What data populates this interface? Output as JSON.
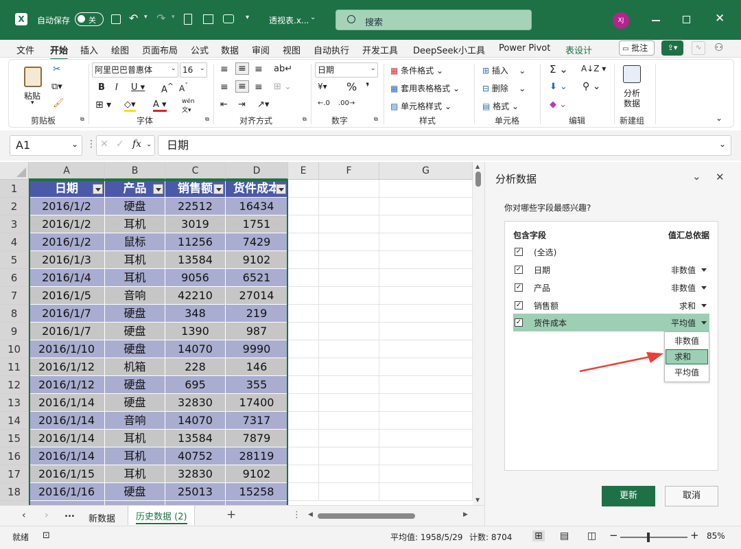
{
  "titlebar": {
    "autosave_label": "自动保存",
    "autosave_state": "关",
    "filename": "透视表.x...",
    "search_placeholder": "搜索",
    "user_initials": "XJ"
  },
  "menu": {
    "tabs": [
      "文件",
      "开始",
      "插入",
      "绘图",
      "页面布局",
      "公式",
      "数据",
      "审阅",
      "视图",
      "自动执行",
      "开发工具",
      "DeepSeek小工具",
      "Power Pivot",
      "表设计"
    ],
    "active": "开始",
    "comments_label": "批注"
  },
  "ribbon": {
    "paste_label": "粘贴",
    "font_name": "阿里巴巴普惠体",
    "font_size": "16",
    "number_format": "日期",
    "cond_format": "条件格式",
    "table_format": "套用表格格式",
    "cell_style": "单元格样式",
    "insert": "插入",
    "delete": "删除",
    "format": "格式",
    "analyze_line1": "分析",
    "analyze_line2": "数据",
    "groups": [
      "剪贴板",
      "字体",
      "对齐方式",
      "数字",
      "样式",
      "单元格",
      "编辑",
      "新建组"
    ]
  },
  "formulabar": {
    "cell_ref": "A1",
    "formula": "日期"
  },
  "sheet": {
    "columns": [
      "A",
      "B",
      "C",
      "D",
      "E",
      "F",
      "G"
    ],
    "headers": [
      "日期",
      "产品",
      "销售额",
      "货件成本"
    ],
    "rows": [
      [
        "2016/1/2",
        "硬盘",
        "22512",
        "16434"
      ],
      [
        "2016/1/2",
        "耳机",
        "3019",
        "1751"
      ],
      [
        "2016/1/2",
        "鼠标",
        "11256",
        "7429"
      ],
      [
        "2016/1/3",
        "耳机",
        "13584",
        "9102"
      ],
      [
        "2016/1/4",
        "耳机",
        "9056",
        "6521"
      ],
      [
        "2016/1/5",
        "音响",
        "42210",
        "27014"
      ],
      [
        "2016/1/7",
        "硬盘",
        "348",
        "219"
      ],
      [
        "2016/1/7",
        "硬盘",
        "1390",
        "987"
      ],
      [
        "2016/1/10",
        "硬盘",
        "14070",
        "9990"
      ],
      [
        "2016/1/12",
        "机箱",
        "228",
        "146"
      ],
      [
        "2016/1/12",
        "硬盘",
        "695",
        "355"
      ],
      [
        "2016/1/14",
        "硬盘",
        "32830",
        "17400"
      ],
      [
        "2016/1/14",
        "音响",
        "14070",
        "7317"
      ],
      [
        "2016/1/14",
        "耳机",
        "13584",
        "7879"
      ],
      [
        "2016/1/14",
        "耳机",
        "40752",
        "28119"
      ],
      [
        "2016/1/15",
        "耳机",
        "32830",
        "9102"
      ],
      [
        "2016/1/16",
        "硬盘",
        "25013",
        "15258"
      ]
    ],
    "row_numbers": [
      "1",
      "2",
      "3",
      "4",
      "5",
      "6",
      "7",
      "8",
      "9",
      "10",
      "11",
      "12",
      "13",
      "14",
      "15",
      "16",
      "17",
      "18"
    ]
  },
  "tabs": {
    "ellipsis": "...",
    "sheet1": "新数据",
    "sheet2": "历史数据 (2)",
    "add": "+"
  },
  "panel": {
    "title": "分析数据",
    "question": "你对哪些字段最感兴趣?",
    "col_include": "包含字段",
    "col_summary": "值汇总依据",
    "fields": [
      {
        "name": "(全选)",
        "summary": ""
      },
      {
        "name": "日期",
        "summary": "非数值"
      },
      {
        "name": "产品",
        "summary": "非数值"
      },
      {
        "name": "销售额",
        "summary": "求和"
      },
      {
        "name": "货件成本",
        "summary": "平均值"
      }
    ],
    "dropdown_options": [
      "非数值",
      "求和",
      "平均值"
    ],
    "update_button": "更新",
    "cancel_button": "取消"
  },
  "status": {
    "ready": "就绪",
    "average": "平均值: 1958/5/29",
    "count": "计数: 8704",
    "zoom": "85%"
  },
  "colors": {
    "excel_green": "#1e7145",
    "header_fill": "#4a5aa8",
    "band_dark": "#a9add0",
    "band_light": "#c6c6c6",
    "panel_highlight": "#9dcfb4",
    "annotation_arrow": "#e8403a"
  }
}
